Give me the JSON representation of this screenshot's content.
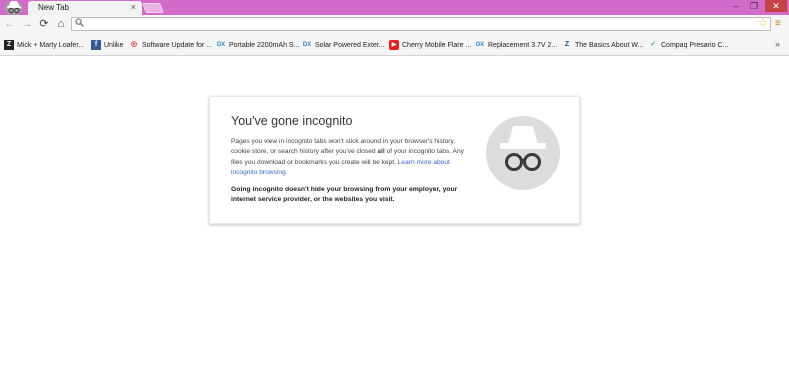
{
  "tab": {
    "title": "New Tab",
    "close_glyph": "×"
  },
  "window": {
    "minimize": "–",
    "maximize": "❐",
    "close": "✕"
  },
  "toolbar": {
    "back": "←",
    "forward": "→",
    "reload": "⟳",
    "home": "⌂",
    "search_glyph": "🔍",
    "omnibox_value": "",
    "star": "☆",
    "menu": "≡"
  },
  "bookmarks": {
    "items": [
      {
        "label": "Mick + Marty Loafer...",
        "icon": "Z",
        "icon_name": "zazzle-favicon-icon",
        "color": "#222222",
        "fg": "#ffffff"
      },
      {
        "label": "Unlike",
        "icon": "f",
        "icon_name": "facebook-favicon-icon",
        "color": "#3b5998",
        "fg": "#ffffff"
      },
      {
        "label": "Software Update for ...",
        "icon": "◎",
        "icon_name": "software-update-favicon-icon",
        "color": "#ffffff",
        "fg": "#d32f2f"
      },
      {
        "label": "Portable 2200mAh S...",
        "icon": "DX",
        "icon_name": "dx-favicon-icon",
        "color": "#ffffff",
        "fg": "#2b8ad8"
      },
      {
        "label": "Solar Powered Exter...",
        "icon": "DX",
        "icon_name": "dx-favicon-icon",
        "color": "#ffffff",
        "fg": "#2b8ad8"
      },
      {
        "label": "Cherry Mobile Flare ...",
        "icon": "▶",
        "icon_name": "youtube-favicon-icon",
        "color": "#e62117",
        "fg": "#ffffff"
      },
      {
        "label": "Replacement 3.7V 2...",
        "icon": "DX",
        "icon_name": "dx-favicon-icon",
        "color": "#ffffff",
        "fg": "#2b8ad8"
      },
      {
        "label": "The Basics About W...",
        "icon": "Z",
        "icon_name": "blue-favicon-icon",
        "color": "#ffffff",
        "fg": "#1f4f9c"
      },
      {
        "label": "Compaq Presario C...",
        "icon": "✓",
        "icon_name": "checkmark-favicon-icon",
        "color": "#ffffff",
        "fg": "#4caf50"
      }
    ],
    "more": "»"
  },
  "incognito": {
    "title": "You've gone incognito",
    "body_before_bold": "Pages you view in incognito tabs won't stick around in your browser's history, cookie store, or search history after you've closed ",
    "body_bold": "all",
    "body_after_bold": " of your incognito tabs. Any files you download or bookmarks you create will be kept. ",
    "link": "Learn more about incognito browsing",
    "warning": "Going incognito doesn't hide your browsing from your employer, your internet service provider, or the websites you visit."
  },
  "colors": {
    "titlebar": "#d36bcb",
    "link": "#3367d6",
    "close_button": "#c74343"
  }
}
